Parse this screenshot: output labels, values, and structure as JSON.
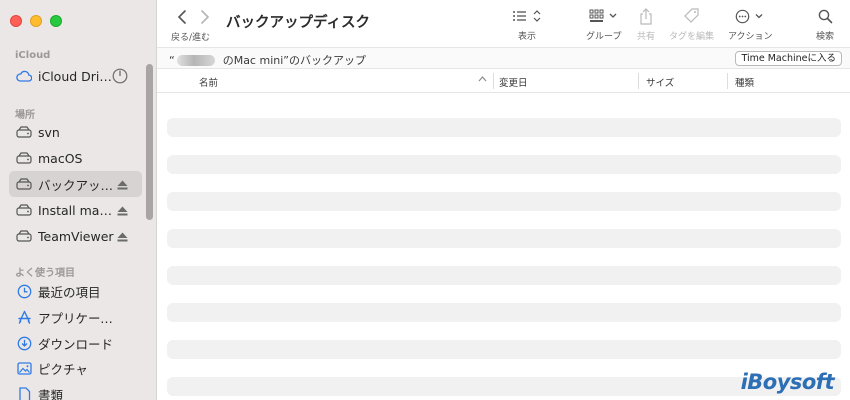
{
  "sidebar": {
    "sections": [
      {
        "title": "iCloud"
      },
      {
        "title": "場所"
      },
      {
        "title": "よく使う項目"
      }
    ],
    "items": [
      {
        "label": "iCloud Drive",
        "icon": "cloud-icon"
      },
      {
        "label": "svn",
        "icon": "drive-icon"
      },
      {
        "label": "macOS",
        "icon": "drive-icon"
      },
      {
        "label": "バックアップディスク",
        "icon": "drive-icon",
        "selected": true
      },
      {
        "label": "Install macOS",
        "icon": "drive-icon"
      },
      {
        "label": "TeamViewer",
        "icon": "drive-icon"
      },
      {
        "label": "最近の項目",
        "icon": "clock-icon"
      },
      {
        "label": "アプリケーション",
        "icon": "apps-icon"
      },
      {
        "label": "ダウンロード",
        "icon": "download-icon"
      },
      {
        "label": "ピクチャ",
        "icon": "picture-icon"
      },
      {
        "label": "書類",
        "icon": "document-icon"
      }
    ]
  },
  "toolbar": {
    "nav_label": "戻る/進む",
    "title": "バックアップディスク",
    "view_label": "表示",
    "group_label": "グループ",
    "share_label": "共有",
    "tags_label": "タグを編集",
    "action_label": "アクション",
    "search_label": "検索"
  },
  "pathbar": {
    "prefix": "“",
    "suffix": "のMac mini”のバックアップ",
    "tm_button": "Time Machineに入る"
  },
  "columns": {
    "name": "名前",
    "date": "変更日",
    "size": "サイズ",
    "kind": "種類"
  },
  "watermark": "iBoysoft",
  "colors": {
    "accent": "#2f7be5",
    "sidebar_bg": "#ece7e7",
    "stripe": "#f1f1f1"
  }
}
